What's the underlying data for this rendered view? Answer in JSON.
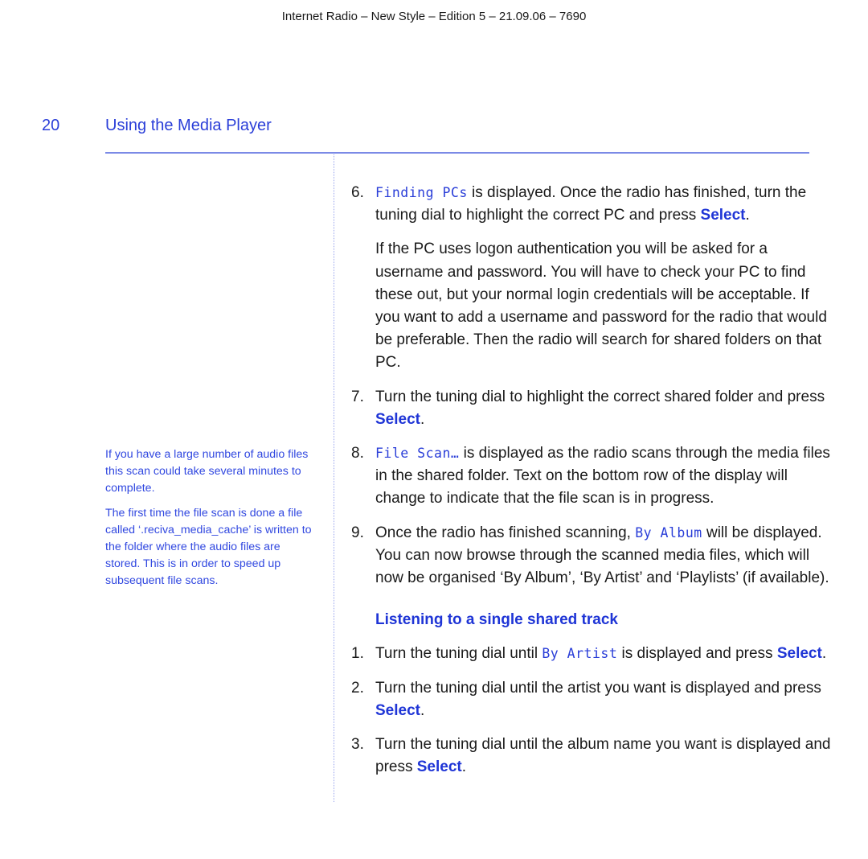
{
  "header": {
    "running_title": "Internet Radio – New Style – Edition 5 – 21.09.06 – 7690"
  },
  "page": {
    "number": "20",
    "section_title": "Using the Media Player"
  },
  "colors": {
    "accent": "#2a3ed8",
    "rule": "#7b8ae6",
    "body_text": "#1a1a1a"
  },
  "sidenotes": [
    "If you have a large number of audio files this scan could take several minutes to complete.",
    "The first time the file scan is done a file called ‘.reciva_media_cache’ is written to the folder where the audio files are stored. This is in order to speed up subsequent file scans."
  ],
  "steps": {
    "s6": {
      "num": "6.",
      "lcd": "Finding PCs",
      "text_a": " is displayed. Once the radio has finished, turn the tuning dial to highlight the correct PC and press ",
      "kw": "Select",
      "text_b": ".",
      "para2": "If the PC uses logon authentication you will be asked for a username and password. You will have to check your PC to find these out, but your normal login credentials will be acceptable. If you want to add a username and password for the radio that would be preferable. Then the radio will search for shared folders on that PC."
    },
    "s7": {
      "num": "7.",
      "text_a": "Turn the tuning dial to highlight the correct shared folder and press ",
      "kw": "Select",
      "text_b": "."
    },
    "s8": {
      "num": "8.",
      "lcd": "File Scan…",
      "text_a": " is displayed as the radio scans through the media files in the shared folder. Text on the bottom row of the display will change to indicate that the file scan is in progress."
    },
    "s9": {
      "num": "9.",
      "text_a": "Once the radio has finished scanning, ",
      "lcd": "By Album",
      "text_b": " will be displayed. You can now browse through the scanned media files, which will now be organised ‘By Album’, ‘By Artist’ and ‘Playlists’ (if available)."
    }
  },
  "subsection": {
    "title": "Listening to a single shared track",
    "steps": {
      "s1": {
        "num": "1.",
        "text_a": "Turn the tuning dial until ",
        "lcd": "By Artist",
        "text_b": " is displayed and press ",
        "kw": "Select",
        "text_c": "."
      },
      "s2": {
        "num": "2.",
        "text_a": "Turn the tuning dial until the artist you want is displayed and press ",
        "kw": "Select",
        "text_b": "."
      },
      "s3": {
        "num": "3.",
        "text_a": "Turn the tuning dial until the album name you want is displayed and press ",
        "kw": "Select",
        "text_b": "."
      }
    }
  }
}
